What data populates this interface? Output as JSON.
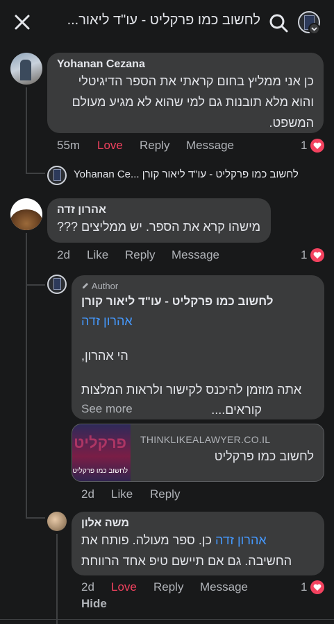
{
  "header": {
    "title": "לחשוב כמו פרקליט - עו\"ד ליאור...",
    "icons": {
      "close": "close-icon",
      "search": "search-icon",
      "dropdown": "chevron-down-icon"
    }
  },
  "colors": {
    "background": "#18191a",
    "bubble": "#3a3b3c",
    "love": "#f3425f",
    "link": "#4599ff",
    "muted": "#b0b3b8"
  },
  "comments": [
    {
      "author": "Yohanan Cezana",
      "lines": [
        "כן אני ממליץ בחום קראתי את הספר הדיגיטלי",
        "והוא מלא תובנות גם למי שהוא לא מגיע מעולם",
        "המשפט."
      ],
      "time": "55m",
      "reaction": "Love",
      "reply": "Reply",
      "message": "Message",
      "react_count": "1",
      "reply_preview": "Yohanan Ce... לחשוב כמו פרקליט - עו\"ד ליאור קורן"
    },
    {
      "author": "אהרון זדה",
      "lines": [
        "מישהו קרא את הספר. יש ממליצים ???"
      ],
      "time": "2d",
      "reaction": "Like",
      "reply": "Reply",
      "message": "Message",
      "react_count": "1"
    }
  ],
  "page_reply": {
    "badge": "Author",
    "author": "לחשוב כמו פרקליט - עו\"ד ליאור קורן",
    "mention": "אהרון זדה",
    "greeting": "הי אהרון,",
    "line1": "אתה מוזמן להיכנס לקישור ולראות המלצות",
    "line2": "קוראים....",
    "see_more": "See more",
    "link_card": {
      "domain": "THINKLIKEALAWYER.CO.IL",
      "title": "לחשוב כמו פרקליט",
      "thumb_top": "פרקליט",
      "thumb_bottom": "לחשוב כמו פרקליט"
    },
    "time": "2d",
    "reaction": "Like",
    "reply": "Reply"
  },
  "moshe_reply": {
    "author": "משה אלון",
    "mention": "אהרון זדה",
    "line1_rest": " כן. ספר מעולה. פותח את",
    "line2": "החשיבה. גם אם תיישם טיפ אחד הרווחת",
    "time": "2d",
    "reaction": "Love",
    "reply": "Reply",
    "message": "Message",
    "react_count": "1",
    "hide": "Hide"
  }
}
